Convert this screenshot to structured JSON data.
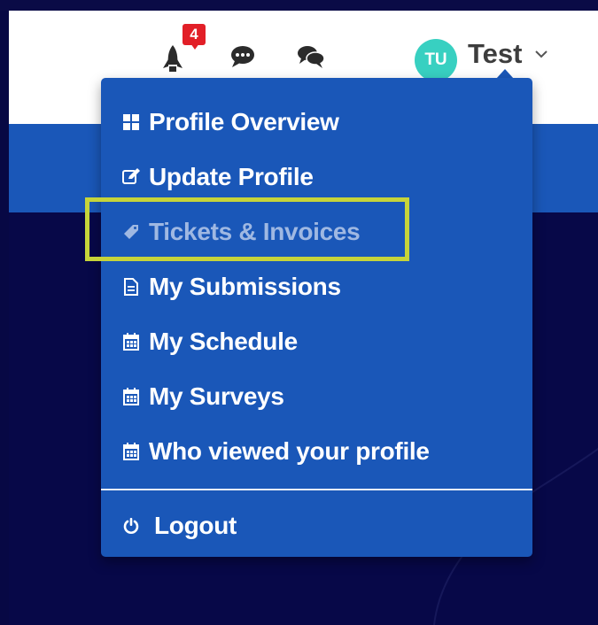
{
  "header": {
    "notification_count": "4",
    "avatar_initials": "TU",
    "user_name": "Test"
  },
  "menu": {
    "items": [
      {
        "label": "Profile Overview",
        "icon": "grid-icon"
      },
      {
        "label": "Update Profile",
        "icon": "edit-icon"
      },
      {
        "label": "Tickets & Invoices",
        "icon": "ticket-icon"
      },
      {
        "label": "My Submissions",
        "icon": "document-icon"
      },
      {
        "label": "My Schedule",
        "icon": "calendar-icon"
      },
      {
        "label": "My Surveys",
        "icon": "calendar-icon"
      },
      {
        "label": "Who viewed your profile",
        "icon": "calendar-icon"
      }
    ],
    "logout": {
      "label": "Logout",
      "icon": "power-icon"
    }
  },
  "colors": {
    "menu_bg": "#1a57b8",
    "page_bg": "#070844",
    "badge": "#e21f27",
    "avatar": "#38d0c1",
    "highlight": "#c6d43a"
  }
}
